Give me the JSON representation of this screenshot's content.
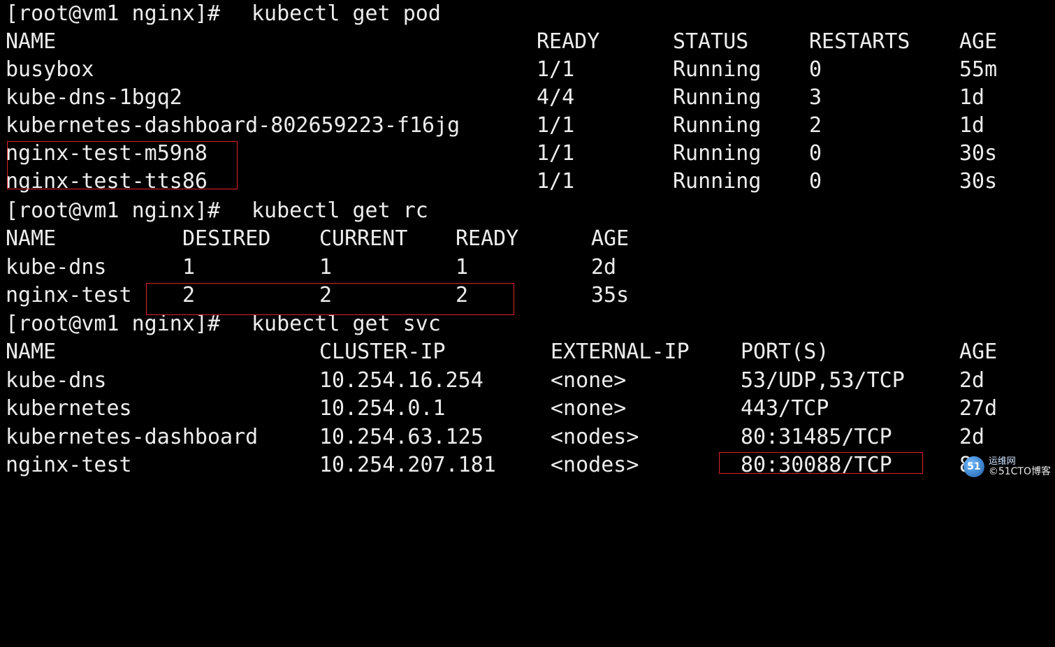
{
  "terminal": {
    "prompt": "[root@vm1 nginx]#",
    "colors": {
      "background": "#000000",
      "text": "#ededed",
      "highlight_border": "#e0242b"
    },
    "pod_section": {
      "command": "kubectl get pod",
      "headers": [
        "NAME",
        "READY",
        "STATUS",
        "RESTARTS",
        "AGE"
      ],
      "rows": [
        [
          "busybox",
          "1/1",
          "Running",
          "0",
          "55m"
        ],
        [
          "kube-dns-1bgq2",
          "4/4",
          "Running",
          "3",
          "1d"
        ],
        [
          "kubernetes-dashboard-802659223-f16jg",
          "1/1",
          "Running",
          "2",
          "1d"
        ],
        [
          "nginx-test-m59n8",
          "1/1",
          "Running",
          "0",
          "30s"
        ],
        [
          "nginx-test-tts86",
          "1/1",
          "Running",
          "0",
          "30s"
        ]
      ]
    },
    "rc_section": {
      "command": "kubectl get rc",
      "headers": [
        "NAME",
        "DESIRED",
        "CURRENT",
        "READY",
        "AGE"
      ],
      "rows": [
        [
          "kube-dns",
          "1",
          "1",
          "1",
          "2d"
        ],
        [
          "nginx-test",
          "2",
          "2",
          "2",
          "35s"
        ]
      ]
    },
    "svc_section": {
      "command": "kubectl get svc",
      "headers": [
        "NAME",
        "CLUSTER-IP",
        "EXTERNAL-IP",
        "PORT(S)",
        "AGE"
      ],
      "rows": [
        [
          "kube-dns",
          "10.254.16.254",
          "<none>",
          "53/UDP,53/TCP",
          "2d"
        ],
        [
          "kubernetes",
          "10.254.0.1",
          "<none>",
          "443/TCP",
          "27d"
        ],
        [
          "kubernetes-dashboard",
          "10.254.63.125",
          "<nodes>",
          "80:31485/TCP",
          "2d"
        ],
        [
          "nginx-test",
          "10.254.207.181",
          "<nodes>",
          "80:30088/TCP",
          "8s"
        ]
      ]
    }
  },
  "watermark": {
    "site": "运维网",
    "brand": "©51CTO博客",
    "icon": "51cto-logo-icon"
  }
}
